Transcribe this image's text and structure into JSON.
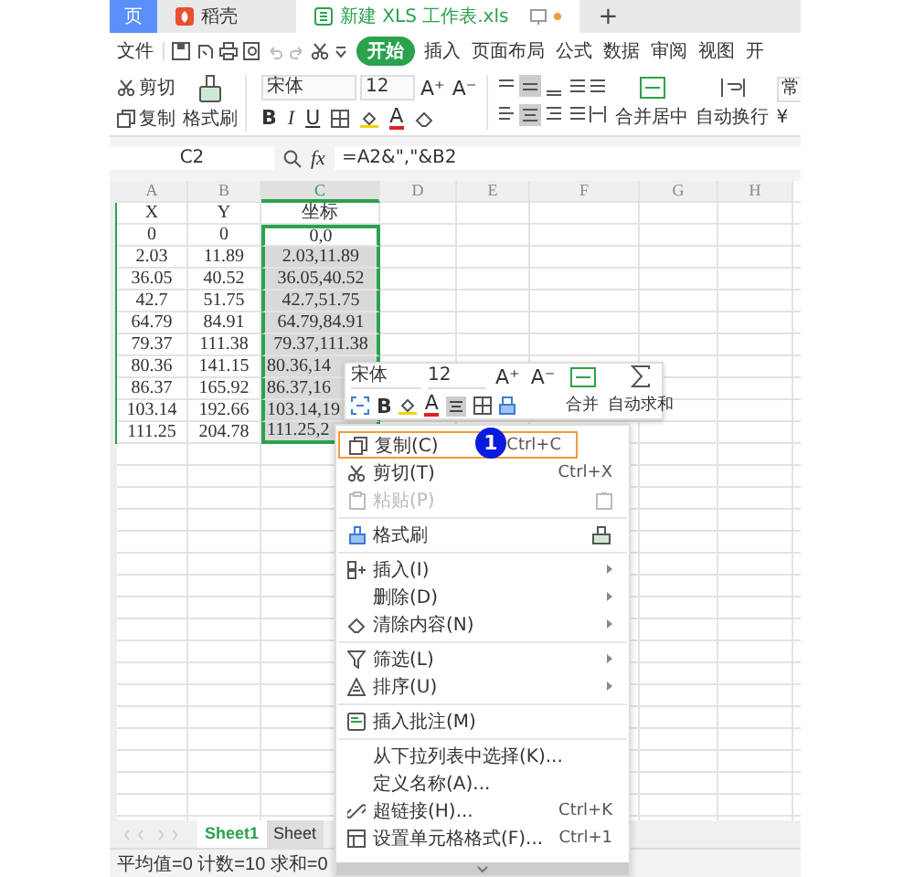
{
  "tabs": [
    {
      "label": "页",
      "selected": false,
      "kind": "home"
    },
    {
      "label": "稻壳",
      "selected": false,
      "kind": "docer"
    },
    {
      "label": "新建 XLS 工作表.xls",
      "selected": true,
      "kind": "file"
    }
  ],
  "new_tab": "+",
  "menu": {
    "file": "文件",
    "tabs": [
      {
        "label": "开始",
        "selected": true
      },
      {
        "label": "插入",
        "selected": false
      },
      {
        "label": "页面布局",
        "selected": false
      },
      {
        "label": "公式",
        "selected": false
      },
      {
        "label": "数据",
        "selected": false
      },
      {
        "label": "审阅",
        "selected": false
      },
      {
        "label": "视图",
        "selected": false
      },
      {
        "label": "开",
        "selected": false
      }
    ]
  },
  "ribbon": {
    "cut": "剪切",
    "copy": "复制",
    "format_painter": "格式刷",
    "font": "宋体",
    "size": "12",
    "grow": "A⁺",
    "shrink": "A⁻",
    "bold": "B",
    "italic": "I",
    "underline": "U",
    "font_color": "A",
    "merge": "合并居中",
    "wrap": "自动换行",
    "number_format": "常",
    "currency": "¥"
  },
  "formula_bar": {
    "cell": "C2",
    "fx": "fx",
    "formula": "=A2&\",\"&B2"
  },
  "table": {
    "columns": [
      {
        "label": "A",
        "selected": false
      },
      {
        "label": "B",
        "selected": false
      },
      {
        "label": "C",
        "selected": true
      },
      {
        "label": "D",
        "selected": false
      },
      {
        "label": "E",
        "selected": false
      },
      {
        "label": "F",
        "selected": false
      },
      {
        "label": "G",
        "selected": false
      },
      {
        "label": "H",
        "selected": false
      }
    ],
    "rows": [
      {
        "a": "X",
        "b": "Y",
        "c": "坐标",
        "c_selected": false,
        "c_active": false
      },
      {
        "a": "0",
        "b": "0",
        "c": "0,0",
        "c_selected": true,
        "c_active": true
      },
      {
        "a": "2.03",
        "b": "11.89",
        "c": "2.03,11.89",
        "c_selected": true,
        "c_active": false
      },
      {
        "a": "36.05",
        "b": "40.52",
        "c": "36.05,40.52",
        "c_selected": true,
        "c_active": false
      },
      {
        "a": "42.7",
        "b": "51.75",
        "c": "42.7,51.75",
        "c_selected": true,
        "c_active": false
      },
      {
        "a": "64.79",
        "b": "84.91",
        "c": "64.79,84.91",
        "c_selected": true,
        "c_active": false
      },
      {
        "a": "79.37",
        "b": "111.38",
        "c": "79.37,111.38",
        "c_selected": true,
        "c_active": false
      },
      {
        "a": "80.36",
        "b": "141.15",
        "c": "80.36,14",
        "c_selected": true,
        "c_active": false
      },
      {
        "a": "86.37",
        "b": "165.92",
        "c": "86.37,16",
        "c_selected": true,
        "c_active": false
      },
      {
        "a": "103.14",
        "b": "192.66",
        "c": "103.14,19",
        "c_selected": true,
        "c_active": false
      },
      {
        "a": "111.25",
        "b": "204.78",
        "c": "111.25,2",
        "c_selected": true,
        "c_active": false
      }
    ]
  },
  "mini_toolbar": {
    "font": "宋体",
    "size": "12",
    "grow": "A⁺",
    "shrink": "A⁻",
    "bold": "B",
    "font_color": "A",
    "merge": "合并",
    "autosum": "自动求和"
  },
  "context_menu": [
    {
      "label": "复制(C)",
      "shortcut": "Ctrl+C",
      "disabled": false,
      "submenu": false,
      "highlighted": true,
      "separator_before": false
    },
    {
      "label": "剪切(T)",
      "shortcut": "Ctrl+X",
      "disabled": false,
      "submenu": false,
      "highlighted": false,
      "separator_before": false
    },
    {
      "label": "粘贴(P)",
      "disabled": true,
      "submenu": false,
      "highlighted": false,
      "separator_before": false
    },
    {
      "label": "格式刷",
      "disabled": false,
      "submenu": false,
      "highlighted": false,
      "separator_before": true
    },
    {
      "label": "插入(I)",
      "disabled": false,
      "submenu": true,
      "highlighted": false,
      "separator_before": true
    },
    {
      "label": "删除(D)",
      "disabled": false,
      "submenu": true,
      "highlighted": false,
      "separator_before": false
    },
    {
      "label": "清除内容(N)",
      "disabled": false,
      "submenu": true,
      "highlighted": false,
      "separator_before": false
    },
    {
      "label": "筛选(L)",
      "disabled": false,
      "submenu": true,
      "highlighted": false,
      "separator_before": true
    },
    {
      "label": "排序(U)",
      "disabled": false,
      "submenu": true,
      "highlighted": false,
      "separator_before": false
    },
    {
      "label": "插入批注(M)",
      "disabled": false,
      "submenu": false,
      "highlighted": false,
      "separator_before": true
    },
    {
      "label": "从下拉列表中选择(K)...",
      "disabled": false,
      "submenu": false,
      "highlighted": false,
      "separator_before": true
    },
    {
      "label": "定义名称(A)...",
      "disabled": false,
      "submenu": false,
      "highlighted": false,
      "separator_before": false
    },
    {
      "label": "超链接(H)...",
      "shortcut": "Ctrl+K",
      "disabled": false,
      "submenu": false,
      "highlighted": false,
      "separator_before": false
    },
    {
      "label": "设置单元格格式(F)...",
      "shortcut": "Ctrl+1",
      "disabled": false,
      "submenu": false,
      "highlighted": false,
      "separator_before": false
    }
  ],
  "step_badge": "1",
  "sheet_tabs": [
    {
      "label": "Sheet1",
      "selected": true
    },
    {
      "label": "Sheet",
      "selected": false
    }
  ],
  "status_bar": "平均值=0 计数=10 求和=0"
}
